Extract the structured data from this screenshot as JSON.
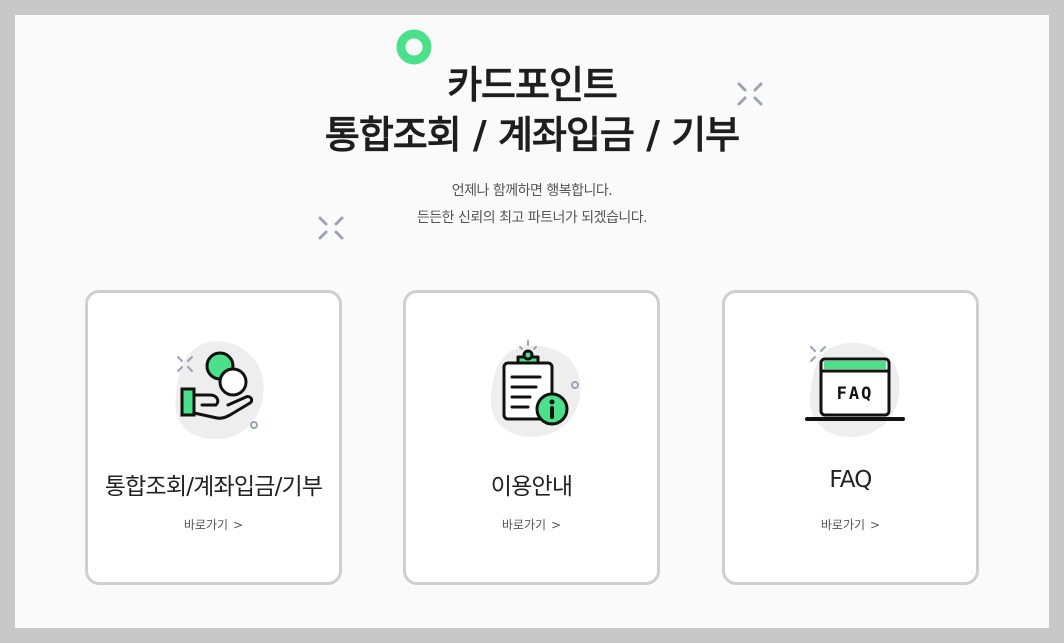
{
  "hero": {
    "title_line1": "카드포인트",
    "title_line2": "통합조회 / 계좌입금 / 기부",
    "subtitle_line1": "언제나 함께하면 행복합니다.",
    "subtitle_line2": "든든한 신뢰의 최고 파트너가 되겠습니다."
  },
  "cards": [
    {
      "label": "통합조회/계좌입금/기부",
      "link": "바로가기",
      "icon": "coin-hand-icon"
    },
    {
      "label": "이용안내",
      "link": "바로가기",
      "icon": "clipboard-info-icon"
    },
    {
      "label": "FAQ",
      "link": "바로가기",
      "icon": "faq-icon",
      "icon_text": "FAQ"
    }
  ],
  "colors": {
    "accent": "#4ce08a",
    "text_dark": "#1e1e1e",
    "card_border": "#cfcfcf",
    "decor_gray": "#9aa4b4",
    "blob": "#eeeeee"
  }
}
